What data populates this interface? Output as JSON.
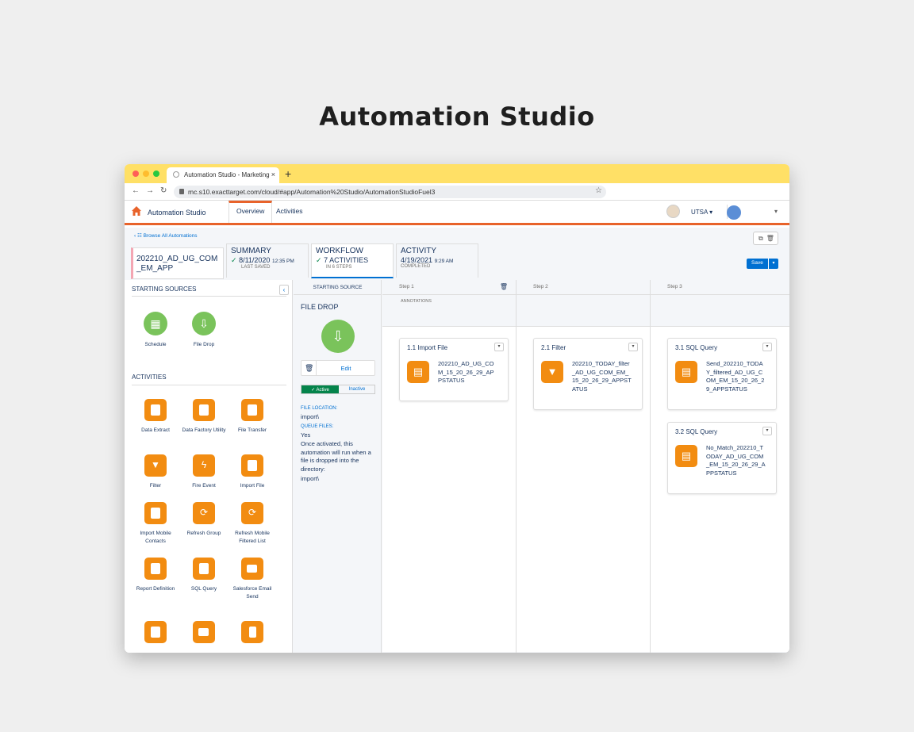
{
  "heading": "Automation Studio",
  "browser": {
    "tab_title": "Automation Studio - Marketing",
    "tab_close": "×",
    "new_tab": "+",
    "url": "mc.s10.exacttarget.com/cloud/#app/Automation%20Studio/AutomationStudioFuel3"
  },
  "app": {
    "title": "Automation Studio",
    "tabs": [
      "Overview",
      "Activities"
    ],
    "business_unit": "UTSA ▾",
    "user_caret": "▾"
  },
  "header": {
    "breadcrumb": "Browse All Automations",
    "automation_name": "202210_AD_UG_COM_EM_APP",
    "summary": {
      "title": "SUMMARY",
      "date": "8/11/2020",
      "time": "12:35 PM",
      "sub": "LAST SAVED"
    },
    "workflow": {
      "title": "WORKFLOW",
      "value": "7 ACTIVITIES",
      "sub": "IN 6 STEPS"
    },
    "activity": {
      "title": "ACTIVITY",
      "date": "4/19/2021",
      "time": "9:29 AM",
      "sub": "COMPLETED"
    },
    "save_label": "Save"
  },
  "palette": {
    "starting_sources_title": "STARTING SOURCES",
    "sources": [
      "Schedule",
      "File Drop"
    ],
    "activities_title": "ACTIVITIES",
    "activities": [
      "Data Extract",
      "Data Factory Utility",
      "File Transfer",
      "Filter",
      "Fire Event",
      "Import File",
      "Import Mobile Contacts",
      "Refresh Group",
      "Refresh Mobile Filtered List",
      "Report Definition",
      "SQL Query",
      "Salesforce Email Send",
      "",
      "",
      ""
    ]
  },
  "source": {
    "header": "STARTING SOURCE",
    "title": "FILE DROP",
    "edit_label": "Edit",
    "active_label": "✓ Active",
    "inactive_label": "Inactive",
    "file_location_label": "FILE LOCATION:",
    "file_location": "import\\",
    "queue_files_label": "QUEUE FILES:",
    "queue_files": "Yes",
    "description": "Once activated, this automation will run when a file is dropped into the directory:",
    "directory": "import\\"
  },
  "steps": [
    {
      "label": "Step 1",
      "annotations": "ANNOTATIONS",
      "activities": [
        {
          "title": "1.1 Import File",
          "name": "202210_AD_UG_COM_15_20_26_29_APPSTATUS"
        }
      ]
    },
    {
      "label": "Step 2",
      "annotations": "",
      "activities": [
        {
          "title": "2.1 Filter",
          "name": "202210_TODAY_filter_AD_UG_COM_EM_15_20_26_29_APPSTATUS"
        }
      ]
    },
    {
      "label": "Step 3",
      "annotations": "",
      "activities": [
        {
          "title": "3.1 SQL Query",
          "name": "Send_202210_TODAY_filtered_AD_UG_COM_EM_15_20_26_29_APPSTATUS"
        },
        {
          "title": "3.2 SQL Query",
          "name": "No_Match_202210_TODAY_AD_UG_COM_EM_15_20_26_29_APPSTATUS"
        }
      ]
    }
  ],
  "icons": {
    "home": "home-icon",
    "schedule": "calendar-icon",
    "file_drop": "folder-download-icon",
    "trash": "trash-icon",
    "copy": "copy-icon",
    "chevron_left": "chevron-left-icon"
  },
  "colors": {
    "accent": "#e8632b",
    "brand_blue": "#0070d2",
    "activity_orange": "#f28c11",
    "source_green": "#7ac35b",
    "tab_bar_yellow": "#ffe066"
  }
}
